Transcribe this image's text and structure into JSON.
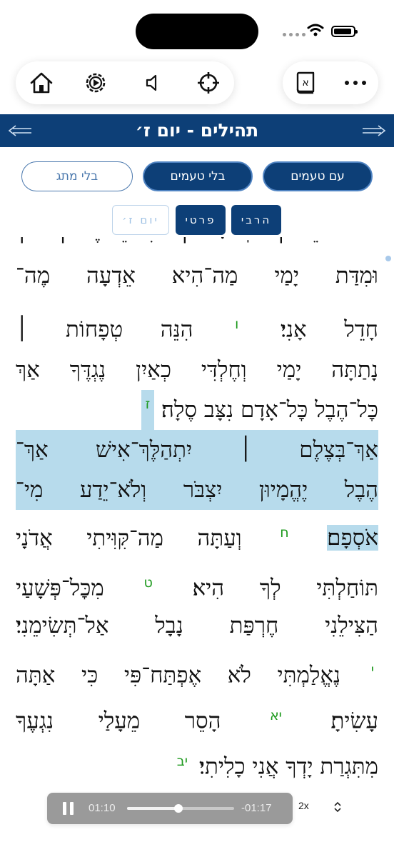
{
  "header": {
    "title": "תהילים - יום ז׳"
  },
  "toolbar": {
    "icons": [
      "home-icon",
      "settings-icon",
      "speaker-icon",
      "crosshair-icon",
      "book-icon",
      "more-icon"
    ]
  },
  "filters": {
    "with_cantillation": "עם טעמים",
    "without_cantillation": "בלי טעמים",
    "without_meteg": "בלי מתג"
  },
  "modes": {
    "public": "הרבי",
    "private": "פרטי",
    "day": "יום ז׳"
  },
  "text_lines": {
    "l0": "־ ֹ ֵ ׀ ֽ ׃ ׀ ִ ֵ ֶ ׀ ׀",
    "l1": "וּמִדַּת יָמַי מַה־הִיא אֵדְעָה מֶה־",
    "l2a": "חָדֵל אָנִי׃",
    "v6": "ו",
    "l2b": "הִנֵּה טְפָחוֹת ׀",
    "l3": "נָתַתָּה יָמַי וְחֶלְדִּי כְאַיִן נֶגְדֶּךָ אַךְ",
    "l4a": "כׇּל־הֶבֶל כׇּל־אָדָם נִצָּב סֶלָה׃",
    "v7": "ז",
    "l5": "אַךְ־בְּצֶלֶם ׀ יִתְהַלֶּךְ־אִישׁ אַךְ־",
    "l6": "הֶבֶל יֶהֱמָיוּן יִצְבֹּר וְלֹא־יֵדַע מִי־",
    "l7a": "אֹסְפָם׃",
    "v8": "ח",
    "l7b": "וְעַתָּה מַה־קִּוִּיתִי אֲדֹנָי",
    "l8a": "תּוֹחַלְתִּי לְךָ הִיא׃",
    "v9": "ט",
    "l8b": "מִכׇּל־פְּשָׁעַי",
    "l9": "הַצִּילֵנִי חֶרְפַּת נָבָל אַל־תְּשִׂימֵנִי׃",
    "v10": "י",
    "l10": "נֶאֱלַמְתִּי לֹא אֶפְתַּח־פִּי כִּי אַתָּה",
    "l11a": "עָשִׂיתָ׃",
    "v11": "יא",
    "l11b": "הָסֵר מֵעָלַי נִגְעֶךָ",
    "l12a": "מִתִּגְרַת יָדְךָ אֲנִי כָלִיתִי׃",
    "v12": "יב"
  },
  "player": {
    "elapsed": "01:10",
    "remaining": "-01:17",
    "speed": "2x",
    "progress": 0.48
  },
  "colors": {
    "navy": "#0d3f77",
    "highlight": "#b7dbec",
    "verse_number": "#1e9a1e"
  }
}
